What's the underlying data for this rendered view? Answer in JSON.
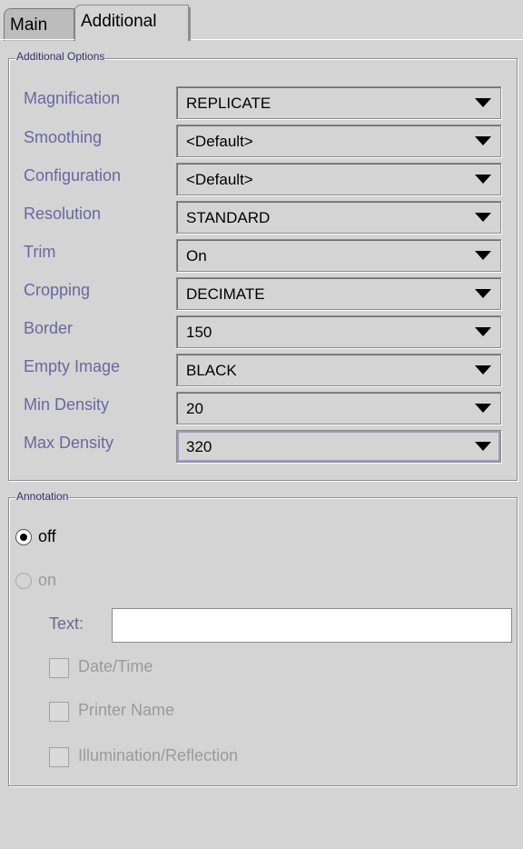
{
  "tabs": [
    {
      "label": "Main",
      "selected": false
    },
    {
      "label": "Additional",
      "selected": true
    }
  ],
  "additional_options": {
    "title": "Additional Options",
    "rows": [
      {
        "label": "Magnification",
        "value": "REPLICATE"
      },
      {
        "label": "Smoothing",
        "value": "<Default>"
      },
      {
        "label": "Configuration",
        "value": "<Default>"
      },
      {
        "label": "Resolution",
        "value": "STANDARD"
      },
      {
        "label": "Trim",
        "value": "On"
      },
      {
        "label": "Cropping",
        "value": "DECIMATE"
      },
      {
        "label": "Border",
        "value": "150"
      },
      {
        "label": "Empty Image",
        "value": "BLACK"
      },
      {
        "label": "Min Density",
        "value": "20"
      },
      {
        "label": "Max Density",
        "value": "320"
      }
    ]
  },
  "annotation": {
    "title": "Annotation",
    "off_label": "off",
    "on_label": "on",
    "selected": "off",
    "text_label": "Text:",
    "text_value": "",
    "checkboxes": [
      {
        "label": "Date/Time",
        "checked": false
      },
      {
        "label": "Printer Name",
        "checked": false
      },
      {
        "label": "Illumination/Reflection",
        "checked": false
      }
    ]
  }
}
